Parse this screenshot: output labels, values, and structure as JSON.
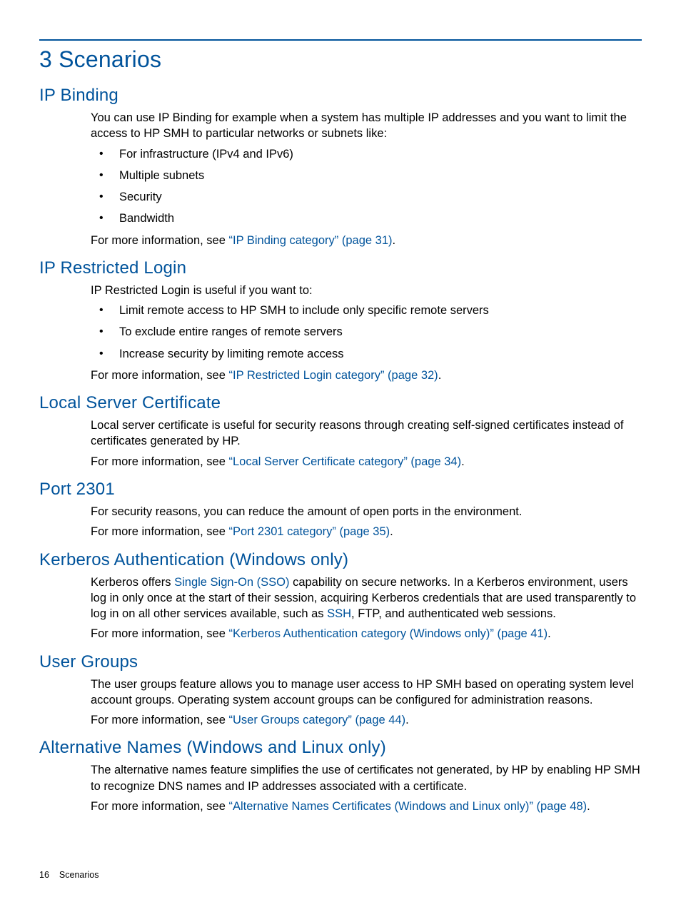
{
  "chapter_title": "3 Scenarios",
  "sections": {
    "ip_binding": {
      "title": "IP Binding",
      "intro": "You can use IP Binding for example when a system has multiple IP addresses and you want to limit the access to HP SMH to particular networks or subnets like:",
      "bullets": [
        "For infrastructure (IPv4 and IPv6)",
        "Multiple subnets",
        "Security",
        "Bandwidth"
      ],
      "more_prefix": "For more information, see ",
      "more_link": "“IP Binding category” (page 31)",
      "more_suffix": "."
    },
    "ip_restricted": {
      "title": "IP Restricted Login",
      "intro": "IP Restricted Login is useful if you want to:",
      "bullets": [
        "Limit remote access to HP SMH to include only specific remote servers",
        "To exclude entire ranges of remote servers",
        "Increase security by limiting remote access"
      ],
      "more_prefix": "For more information, see ",
      "more_link": "“IP Restricted Login category” (page 32)",
      "more_suffix": "."
    },
    "local_cert": {
      "title": "Local Server Certificate",
      "intro": "Local server certificate is useful for security reasons through creating self-signed certificates instead of certificates generated by HP.",
      "more_prefix": "For more information, see ",
      "more_link": "“Local Server Certificate category” (page 34)",
      "more_suffix": "."
    },
    "port_2301": {
      "title": "Port 2301",
      "intro": "For security reasons, you can reduce the amount of open ports in the environment.",
      "more_prefix": "For more information, see ",
      "more_link": "“Port 2301 category” (page 35)",
      "more_suffix": "."
    },
    "kerberos": {
      "title": "Kerberos Authentication (Windows only)",
      "p1_a": "Kerberos offers ",
      "p1_link1": "Single Sign-On (SSO)",
      "p1_b": " capability on secure networks. In a Kerberos environment, users log in only once at the start of their session, acquiring Kerberos credentials that are used transparently to log in on all other services available, such as ",
      "p1_link2": "SSH",
      "p1_c": ", FTP, and authenticated web sessions.",
      "more_prefix": "For more information, see ",
      "more_link": "“Kerberos Authentication category (Windows only)” (page 41)",
      "more_suffix": "."
    },
    "user_groups": {
      "title": "User Groups",
      "intro": "The user groups feature allows you to manage user access to HP SMH based on operating system level account groups. Operating system account groups can be configured for administration reasons.",
      "more_prefix": "For more information, see ",
      "more_link": "“User Groups category” (page 44)",
      "more_suffix": "."
    },
    "alt_names": {
      "title": "Alternative Names (Windows and Linux only)",
      "intro": "The alternative names feature simplifies the use of certificates not generated, by HP by enabling HP SMH to recognize DNS names and IP addresses associated with a certificate.",
      "more_prefix": "For more information, see ",
      "more_link": "“Alternative Names Certificates (Windows and Linux only)” (page 48)",
      "more_suffix": "."
    }
  },
  "footer": {
    "page_number": "16",
    "page_label": "Scenarios"
  }
}
